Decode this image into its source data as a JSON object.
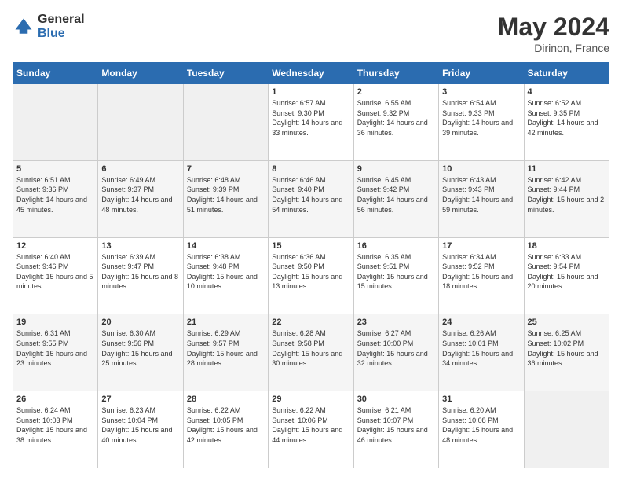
{
  "header": {
    "logo_line1": "General",
    "logo_line2": "Blue",
    "month": "May 2024",
    "location": "Dirinon, France"
  },
  "weekdays": [
    "Sunday",
    "Monday",
    "Tuesday",
    "Wednesday",
    "Thursday",
    "Friday",
    "Saturday"
  ],
  "weeks": [
    [
      {
        "day": "",
        "sunrise": "",
        "sunset": "",
        "daylight": "",
        "empty": true
      },
      {
        "day": "",
        "sunrise": "",
        "sunset": "",
        "daylight": "",
        "empty": true
      },
      {
        "day": "",
        "sunrise": "",
        "sunset": "",
        "daylight": "",
        "empty": true
      },
      {
        "day": "1",
        "sunrise": "Sunrise: 6:57 AM",
        "sunset": "Sunset: 9:30 PM",
        "daylight": "Daylight: 14 hours and 33 minutes."
      },
      {
        "day": "2",
        "sunrise": "Sunrise: 6:55 AM",
        "sunset": "Sunset: 9:32 PM",
        "daylight": "Daylight: 14 hours and 36 minutes."
      },
      {
        "day": "3",
        "sunrise": "Sunrise: 6:54 AM",
        "sunset": "Sunset: 9:33 PM",
        "daylight": "Daylight: 14 hours and 39 minutes."
      },
      {
        "day": "4",
        "sunrise": "Sunrise: 6:52 AM",
        "sunset": "Sunset: 9:35 PM",
        "daylight": "Daylight: 14 hours and 42 minutes."
      }
    ],
    [
      {
        "day": "5",
        "sunrise": "Sunrise: 6:51 AM",
        "sunset": "Sunset: 9:36 PM",
        "daylight": "Daylight: 14 hours and 45 minutes."
      },
      {
        "day": "6",
        "sunrise": "Sunrise: 6:49 AM",
        "sunset": "Sunset: 9:37 PM",
        "daylight": "Daylight: 14 hours and 48 minutes."
      },
      {
        "day": "7",
        "sunrise": "Sunrise: 6:48 AM",
        "sunset": "Sunset: 9:39 PM",
        "daylight": "Daylight: 14 hours and 51 minutes."
      },
      {
        "day": "8",
        "sunrise": "Sunrise: 6:46 AM",
        "sunset": "Sunset: 9:40 PM",
        "daylight": "Daylight: 14 hours and 54 minutes."
      },
      {
        "day": "9",
        "sunrise": "Sunrise: 6:45 AM",
        "sunset": "Sunset: 9:42 PM",
        "daylight": "Daylight: 14 hours and 56 minutes."
      },
      {
        "day": "10",
        "sunrise": "Sunrise: 6:43 AM",
        "sunset": "Sunset: 9:43 PM",
        "daylight": "Daylight: 14 hours and 59 minutes."
      },
      {
        "day": "11",
        "sunrise": "Sunrise: 6:42 AM",
        "sunset": "Sunset: 9:44 PM",
        "daylight": "Daylight: 15 hours and 2 minutes."
      }
    ],
    [
      {
        "day": "12",
        "sunrise": "Sunrise: 6:40 AM",
        "sunset": "Sunset: 9:46 PM",
        "daylight": "Daylight: 15 hours and 5 minutes."
      },
      {
        "day": "13",
        "sunrise": "Sunrise: 6:39 AM",
        "sunset": "Sunset: 9:47 PM",
        "daylight": "Daylight: 15 hours and 8 minutes."
      },
      {
        "day": "14",
        "sunrise": "Sunrise: 6:38 AM",
        "sunset": "Sunset: 9:48 PM",
        "daylight": "Daylight: 15 hours and 10 minutes."
      },
      {
        "day": "15",
        "sunrise": "Sunrise: 6:36 AM",
        "sunset": "Sunset: 9:50 PM",
        "daylight": "Daylight: 15 hours and 13 minutes."
      },
      {
        "day": "16",
        "sunrise": "Sunrise: 6:35 AM",
        "sunset": "Sunset: 9:51 PM",
        "daylight": "Daylight: 15 hours and 15 minutes."
      },
      {
        "day": "17",
        "sunrise": "Sunrise: 6:34 AM",
        "sunset": "Sunset: 9:52 PM",
        "daylight": "Daylight: 15 hours and 18 minutes."
      },
      {
        "day": "18",
        "sunrise": "Sunrise: 6:33 AM",
        "sunset": "Sunset: 9:54 PM",
        "daylight": "Daylight: 15 hours and 20 minutes."
      }
    ],
    [
      {
        "day": "19",
        "sunrise": "Sunrise: 6:31 AM",
        "sunset": "Sunset: 9:55 PM",
        "daylight": "Daylight: 15 hours and 23 minutes."
      },
      {
        "day": "20",
        "sunrise": "Sunrise: 6:30 AM",
        "sunset": "Sunset: 9:56 PM",
        "daylight": "Daylight: 15 hours and 25 minutes."
      },
      {
        "day": "21",
        "sunrise": "Sunrise: 6:29 AM",
        "sunset": "Sunset: 9:57 PM",
        "daylight": "Daylight: 15 hours and 28 minutes."
      },
      {
        "day": "22",
        "sunrise": "Sunrise: 6:28 AM",
        "sunset": "Sunset: 9:58 PM",
        "daylight": "Daylight: 15 hours and 30 minutes."
      },
      {
        "day": "23",
        "sunrise": "Sunrise: 6:27 AM",
        "sunset": "Sunset: 10:00 PM",
        "daylight": "Daylight: 15 hours and 32 minutes."
      },
      {
        "day": "24",
        "sunrise": "Sunrise: 6:26 AM",
        "sunset": "Sunset: 10:01 PM",
        "daylight": "Daylight: 15 hours and 34 minutes."
      },
      {
        "day": "25",
        "sunrise": "Sunrise: 6:25 AM",
        "sunset": "Sunset: 10:02 PM",
        "daylight": "Daylight: 15 hours and 36 minutes."
      }
    ],
    [
      {
        "day": "26",
        "sunrise": "Sunrise: 6:24 AM",
        "sunset": "Sunset: 10:03 PM",
        "daylight": "Daylight: 15 hours and 38 minutes."
      },
      {
        "day": "27",
        "sunrise": "Sunrise: 6:23 AM",
        "sunset": "Sunset: 10:04 PM",
        "daylight": "Daylight: 15 hours and 40 minutes."
      },
      {
        "day": "28",
        "sunrise": "Sunrise: 6:22 AM",
        "sunset": "Sunset: 10:05 PM",
        "daylight": "Daylight: 15 hours and 42 minutes."
      },
      {
        "day": "29",
        "sunrise": "Sunrise: 6:22 AM",
        "sunset": "Sunset: 10:06 PM",
        "daylight": "Daylight: 15 hours and 44 minutes."
      },
      {
        "day": "30",
        "sunrise": "Sunrise: 6:21 AM",
        "sunset": "Sunset: 10:07 PM",
        "daylight": "Daylight: 15 hours and 46 minutes."
      },
      {
        "day": "31",
        "sunrise": "Sunrise: 6:20 AM",
        "sunset": "Sunset: 10:08 PM",
        "daylight": "Daylight: 15 hours and 48 minutes."
      },
      {
        "day": "",
        "sunrise": "",
        "sunset": "",
        "daylight": "",
        "empty": true
      }
    ]
  ]
}
